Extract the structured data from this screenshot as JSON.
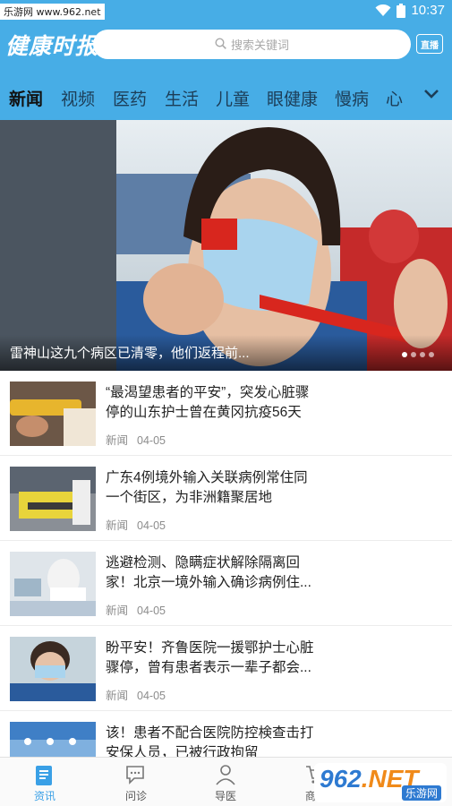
{
  "status_bar": {
    "watermark": "乐游网 www.962.net",
    "time": "10:37"
  },
  "header": {
    "logo": "健康时报",
    "search_placeholder": "搜索关键词",
    "live_label": "直播"
  },
  "tabs": [
    "新闻",
    "视频",
    "医药",
    "生活",
    "儿童",
    "眼健康",
    "慢病",
    "心"
  ],
  "active_tab": "新闻",
  "hero": {
    "caption": "雷神山这九个病区已清零，他们返程前..."
  },
  "news": [
    {
      "title": "“最渴望患者的平安”，突发心脏骤停的山东护士曾在黄冈抗疫56天",
      "category": "新闻",
      "date": "04-05"
    },
    {
      "title": "广东4例境外输入关联病例常住同一个街区，为非洲籍聚居地",
      "category": "新闻",
      "date": "04-05"
    },
    {
      "title": "逃避检测、隐瞒症状解除隔离回家！北京一境外输入确诊病例住...",
      "category": "新闻",
      "date": "04-05"
    },
    {
      "title": "盼平安！齐鲁医院一援鄂护士心脏骤停，曾有患者表示一辈子都会...",
      "category": "新闻",
      "date": "04-05"
    },
    {
      "title": "该！患者不配合医院防控検查击打安保人员，已被行政拘留",
      "category": "",
      "date": ""
    }
  ],
  "bottom_nav": [
    {
      "label": "资讯",
      "icon": "news-icon"
    },
    {
      "label": "问诊",
      "icon": "chat-icon"
    },
    {
      "label": "导医",
      "icon": "doctor-icon"
    },
    {
      "label": "商城",
      "icon": "cart-icon"
    }
  ],
  "watermark_br": {
    "logo_a": "962",
    "logo_b": ".NET",
    "sub": "乐游网"
  },
  "colors": {
    "accent": "#47ade6",
    "active_nav": "#3aa0e6"
  }
}
